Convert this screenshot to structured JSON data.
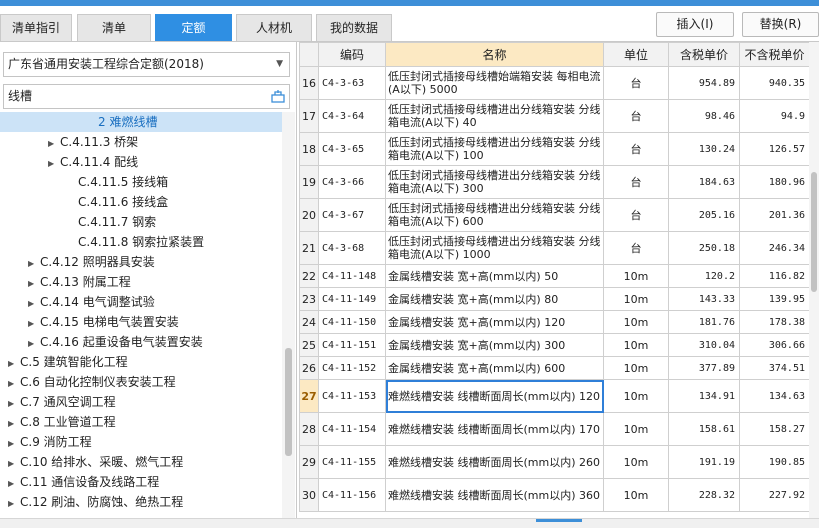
{
  "tabs": [
    {
      "label": "清单指引",
      "active": false
    },
    {
      "label": "清单",
      "active": false
    },
    {
      "label": "定额",
      "active": true
    },
    {
      "label": "人材机",
      "active": false
    },
    {
      "label": "我的数据",
      "active": false
    }
  ],
  "buttons": {
    "insert": "插入(I)",
    "replace": "替换(R)"
  },
  "library_select": {
    "value": "广东省通用安装工程综合定额(2018)"
  },
  "search": {
    "value": "线槽"
  },
  "tree": [
    {
      "label": "2 难燃线槽",
      "selected": true,
      "arrow": ""
    },
    {
      "label": "C.4.11.3 桥架",
      "selected": false,
      "arrow": "▶"
    },
    {
      "label": "C.4.11.4 配线",
      "selected": false,
      "arrow": "▶"
    },
    {
      "label": "C.4.11.5 接线箱",
      "selected": false,
      "arrow": ""
    },
    {
      "label": "C.4.11.6 接线盒",
      "selected": false,
      "arrow": ""
    },
    {
      "label": "C.4.11.7 钢索",
      "selected": false,
      "arrow": ""
    },
    {
      "label": "C.4.11.8 钢索拉紧装置",
      "selected": false,
      "arrow": ""
    },
    {
      "label": "C.4.12 照明器具安装",
      "selected": false,
      "arrow": "▶"
    },
    {
      "label": "C.4.13 附属工程",
      "selected": false,
      "arrow": "▶"
    },
    {
      "label": "C.4.14 电气调整试验",
      "selected": false,
      "arrow": "▶"
    },
    {
      "label": "C.4.15 电梯电气装置安装",
      "selected": false,
      "arrow": "▶"
    },
    {
      "label": "C.4.16 起重设备电气装置安装",
      "selected": false,
      "arrow": "▶"
    },
    {
      "label": "C.5 建筑智能化工程",
      "selected": false,
      "arrow": "▶"
    },
    {
      "label": "C.6 自动化控制仪表安装工程",
      "selected": false,
      "arrow": "▶"
    },
    {
      "label": "C.7 通风空调工程",
      "selected": false,
      "arrow": "▶"
    },
    {
      "label": "C.8 工业管道工程",
      "selected": false,
      "arrow": "▶"
    },
    {
      "label": "C.9 消防工程",
      "selected": false,
      "arrow": "▶"
    },
    {
      "label": "C.10 给排水、采暖、燃气工程",
      "selected": false,
      "arrow": "▶"
    },
    {
      "label": "C.11 通信设备及线路工程",
      "selected": false,
      "arrow": "▶"
    },
    {
      "label": "C.12 刷油、防腐蚀、绝热工程",
      "selected": false,
      "arrow": "▶"
    }
  ],
  "table": {
    "headers": {
      "code": "编码",
      "name": "名称",
      "unit": "单位",
      "tax_price": "含税单价",
      "notax_price": "不含税单价"
    },
    "rows": [
      {
        "n": "16",
        "code": "C4-3-63",
        "name": "低压封闭式插接母线槽始端箱安装 每相电流(A以下) 5000",
        "unit": "台",
        "tax": "954.89",
        "notax": "940.35"
      },
      {
        "n": "17",
        "code": "C4-3-64",
        "name": "低压封闭式插接母线槽进出分线箱安装 分线箱电流(A以下) 40",
        "unit": "台",
        "tax": "98.46",
        "notax": "94.9"
      },
      {
        "n": "18",
        "code": "C4-3-65",
        "name": "低压封闭式插接母线槽进出分线箱安装 分线箱电流(A以下) 100",
        "unit": "台",
        "tax": "130.24",
        "notax": "126.57"
      },
      {
        "n": "19",
        "code": "C4-3-66",
        "name": "低压封闭式插接母线槽进出分线箱安装 分线箱电流(A以下) 300",
        "unit": "台",
        "tax": "184.63",
        "notax": "180.96"
      },
      {
        "n": "20",
        "code": "C4-3-67",
        "name": "低压封闭式插接母线槽进出分线箱安装 分线箱电流(A以下) 600",
        "unit": "台",
        "tax": "205.16",
        "notax": "201.36"
      },
      {
        "n": "21",
        "code": "C4-3-68",
        "name": "低压封闭式插接母线槽进出分线箱安装 分线箱电流(A以下) 1000",
        "unit": "台",
        "tax": "250.18",
        "notax": "246.34"
      },
      {
        "n": "22",
        "code": "C4-11-148",
        "name": "金属线槽安装 宽+高(mm以内) 50",
        "unit": "10m",
        "tax": "120.2",
        "notax": "116.82"
      },
      {
        "n": "23",
        "code": "C4-11-149",
        "name": "金属线槽安装 宽+高(mm以内) 80",
        "unit": "10m",
        "tax": "143.33",
        "notax": "139.95"
      },
      {
        "n": "24",
        "code": "C4-11-150",
        "name": "金属线槽安装 宽+高(mm以内) 120",
        "unit": "10m",
        "tax": "181.76",
        "notax": "178.38"
      },
      {
        "n": "25",
        "code": "C4-11-151",
        "name": "金属线槽安装 宽+高(mm以内) 300",
        "unit": "10m",
        "tax": "310.04",
        "notax": "306.66"
      },
      {
        "n": "26",
        "code": "C4-11-152",
        "name": "金属线槽安装 宽+高(mm以内) 600",
        "unit": "10m",
        "tax": "377.89",
        "notax": "374.51"
      },
      {
        "n": "27",
        "code": "C4-11-153",
        "name": "难燃线槽安装 线槽断面周长(mm以内) 120",
        "unit": "10m",
        "tax": "134.91",
        "notax": "134.63",
        "current": true
      },
      {
        "n": "28",
        "code": "C4-11-154",
        "name": "难燃线槽安装 线槽断面周长(mm以内) 170",
        "unit": "10m",
        "tax": "158.61",
        "notax": "158.27"
      },
      {
        "n": "29",
        "code": "C4-11-155",
        "name": "难燃线槽安装 线槽断面周长(mm以内) 260",
        "unit": "10m",
        "tax": "191.19",
        "notax": "190.85"
      },
      {
        "n": "30",
        "code": "C4-11-156",
        "name": "难燃线槽安装 线槽断面周长(mm以内) 360",
        "unit": "10m",
        "tax": "228.32",
        "notax": "227.92"
      }
    ]
  },
  "colors": {
    "accent": "#2f8fe3",
    "header_highlight": "#fce9c3",
    "selection": "#cce3f7"
  }
}
